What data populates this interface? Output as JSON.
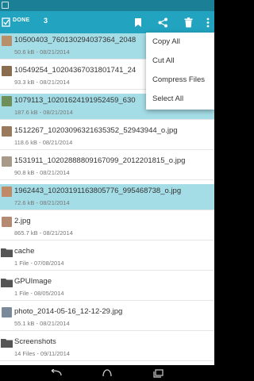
{
  "actionbar": {
    "done_label": "DONE",
    "selected_count": "3",
    "icons": [
      "checkbox-icon",
      "bookmark-icon",
      "share-icon",
      "delete-icon",
      "overflow-icon"
    ]
  },
  "files": [
    {
      "name": "10500403_760130294037364_2048",
      "meta": "50.6 kB - 08/21/2014",
      "selected": true,
      "kind": "image",
      "color": "#b78f6a"
    },
    {
      "name": "10549254_10204367031801741_24",
      "meta": "93.3 kB - 08/21/2014",
      "selected": false,
      "kind": "image",
      "color": "#8a6d4f"
    },
    {
      "name": "1079113_10201624191952459_630",
      "meta": "187.6 kB - 08/21/2014",
      "selected": true,
      "kind": "image",
      "color": "#6f8f5a"
    },
    {
      "name": "1512267_10203096321635352_52943944_o.jpg",
      "meta": "118.6 kB - 08/21/2014",
      "selected": false,
      "kind": "image",
      "color": "#9a7a5c"
    },
    {
      "name": "1531911_10202888809167099_2012201815_o.jpg",
      "meta": "90.8 kB - 08/21/2014",
      "selected": false,
      "kind": "image",
      "color": "#a89a88"
    },
    {
      "name": "1962443_10203191163805776_995468738_o.jpg",
      "meta": "72.6 kB - 08/21/2014",
      "selected": true,
      "kind": "image",
      "color": "#c08a66"
    },
    {
      "name": "2.jpg",
      "meta": "865.7 kB - 08/21/2014",
      "selected": false,
      "kind": "image",
      "color": "#b48a73"
    },
    {
      "name": "cache",
      "meta": "1 File - 07/08/2014",
      "selected": false,
      "kind": "folder",
      "color": "#555555"
    },
    {
      "name": "GPUImage",
      "meta": "1 File - 08/05/2014",
      "selected": false,
      "kind": "folder",
      "color": "#555555"
    },
    {
      "name": "photo_2014-05-16_12-12-29.jpg",
      "meta": "55.1 kB - 08/21/2014",
      "selected": false,
      "kind": "image",
      "color": "#7a8a9a"
    },
    {
      "name": "Screenshots",
      "meta": "14 Files - 09/11/2014",
      "selected": false,
      "kind": "folder",
      "color": "#555555"
    }
  ],
  "menu": {
    "items": [
      "Copy All",
      "Cut All",
      "Compress Files",
      "Select All"
    ]
  },
  "colors": {
    "accent": "#22a3bf",
    "statusbar": "#1b7f95",
    "selected_row": "#a5dde7"
  },
  "navbar": {
    "icons": [
      "back-icon",
      "home-icon",
      "recents-icon"
    ]
  }
}
